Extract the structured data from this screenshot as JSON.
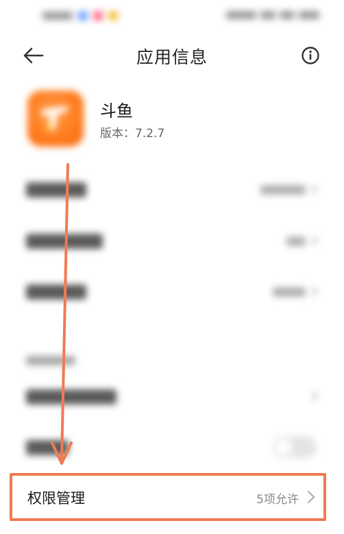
{
  "header": {
    "title": "应用信息"
  },
  "app": {
    "name": "斗鱼",
    "version": "版本：7.2.7"
  },
  "permissions": {
    "label": "权限管理",
    "value": "5项允许"
  },
  "colors": {
    "accent": "#f07a52",
    "app_icon": "#ff7a1a"
  },
  "icons": {
    "back": "arrow-left-icon",
    "info": "info-icon",
    "chevron": "chevron-right-icon"
  }
}
